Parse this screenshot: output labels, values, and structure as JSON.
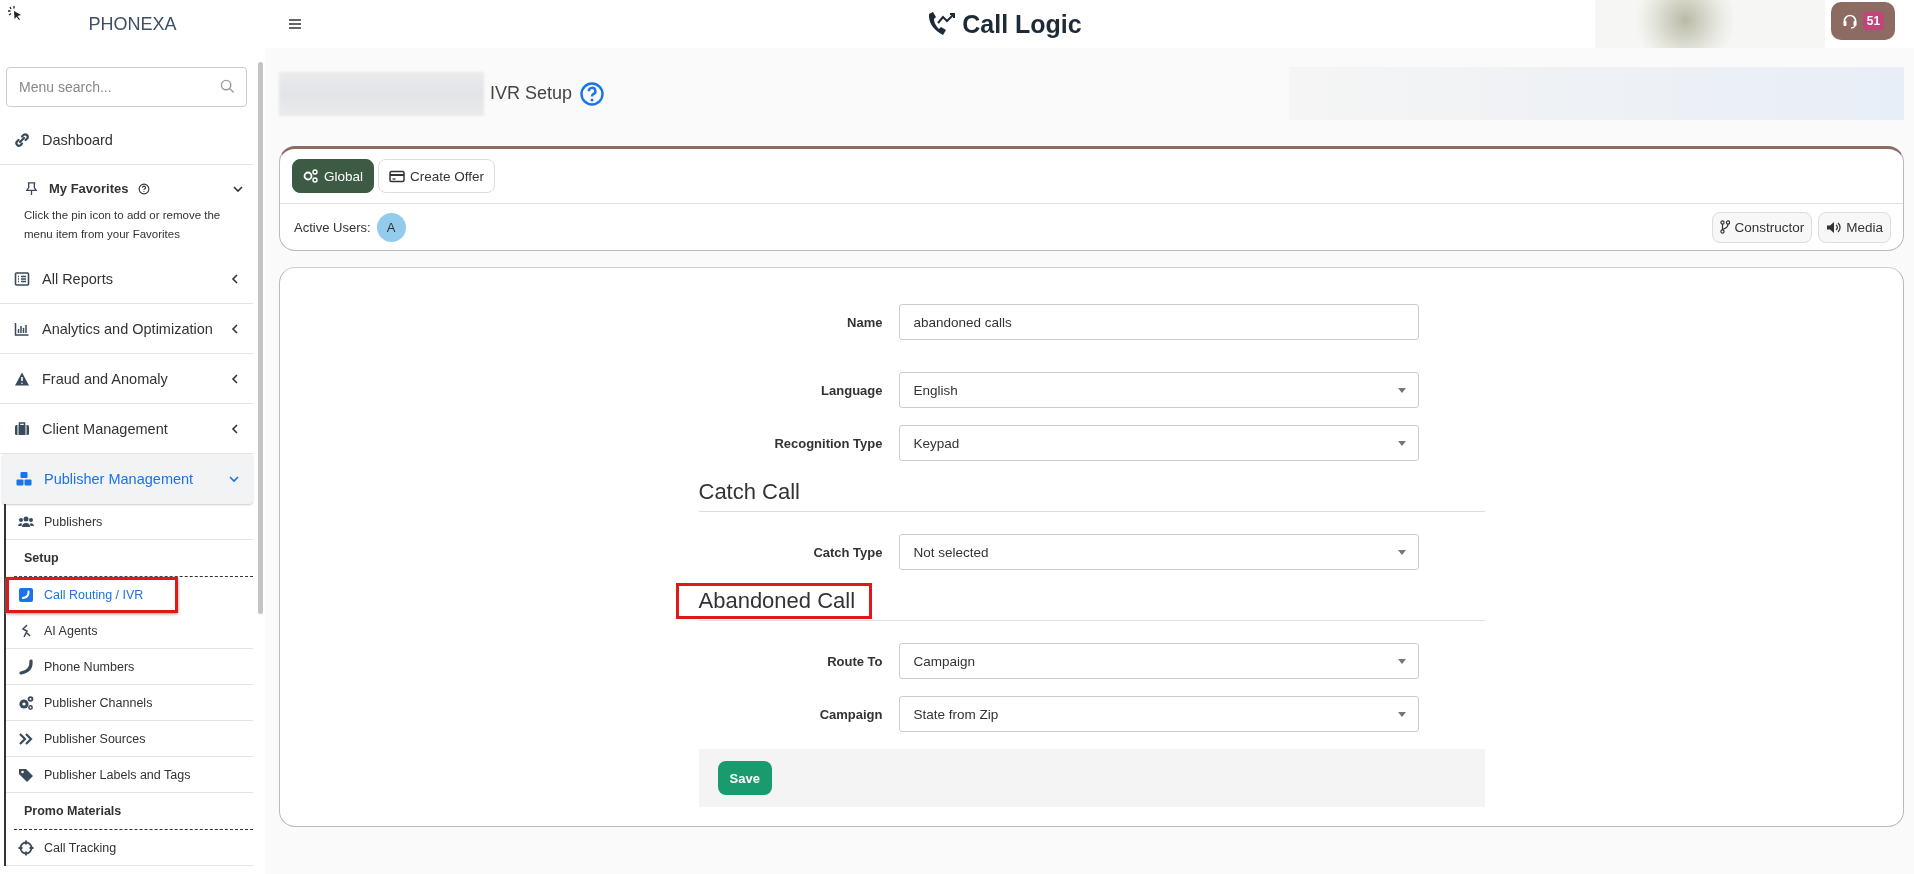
{
  "header": {
    "logo": "PHONEXA",
    "app_title": "Call Logic",
    "notification_count": "51"
  },
  "sidebar": {
    "search": {
      "placeholder": "Menu search..."
    },
    "items": [
      {
        "kind": "link",
        "label": "Dashboard",
        "selected": false
      },
      {
        "kind": "favorites",
        "label": "My Favorites",
        "expanded": true,
        "description": "Click the pin icon to add or remove the menu item from your Favorites"
      },
      {
        "kind": "group",
        "label": "All Reports",
        "expanded": false
      },
      {
        "kind": "group",
        "label": "Analytics and Optimization",
        "expanded": false
      },
      {
        "kind": "group",
        "label": "Fraud and Anomaly",
        "expanded": false
      },
      {
        "kind": "group",
        "label": "Client Management",
        "expanded": false
      },
      {
        "kind": "group",
        "label": "Publisher Management",
        "expanded": true,
        "children": [
          {
            "kind": "link",
            "label": "Publishers",
            "selected": false,
            "highlighted": false
          },
          {
            "kind": "heading",
            "label": "Setup"
          },
          {
            "kind": "link",
            "label": "Call Routing / IVR",
            "selected": true,
            "highlighted": true
          },
          {
            "kind": "link",
            "label": "AI Agents",
            "selected": false,
            "highlighted": false
          },
          {
            "kind": "link",
            "label": "Phone Numbers",
            "selected": false,
            "highlighted": false
          },
          {
            "kind": "link",
            "label": "Publisher Channels",
            "selected": false,
            "highlighted": false
          },
          {
            "kind": "link",
            "label": "Publisher Sources",
            "selected": false,
            "highlighted": false
          },
          {
            "kind": "link",
            "label": "Publisher Labels and Tags",
            "selected": false,
            "highlighted": false
          },
          {
            "kind": "heading",
            "label": "Promo Materials"
          },
          {
            "kind": "link",
            "label": "Call Tracking",
            "selected": false,
            "highlighted": false
          }
        ]
      }
    ]
  },
  "page": {
    "title": "IVR Setup"
  },
  "toolbar": {
    "tabs": [
      {
        "label": "Global",
        "selected": true
      },
      {
        "label": "Create Offer",
        "selected": false
      }
    ],
    "active_users_label": "Active Users:",
    "active_users": [
      {
        "initial": "A"
      }
    ],
    "buttons": [
      "Constructor",
      "Media"
    ]
  },
  "form": {
    "rows": [
      {
        "kind": "text_field",
        "label": "Name",
        "value": "abandoned calls"
      },
      {
        "kind": "select_field",
        "label": "Language",
        "value": "English"
      },
      {
        "kind": "select_field",
        "label": "Recognition Type",
        "value": "Keypad"
      },
      {
        "kind": "heading",
        "text": "Catch Call",
        "highlighted": false
      },
      {
        "kind": "select_field",
        "label": "Catch Type",
        "value": "Not selected"
      },
      {
        "kind": "heading",
        "text": "Abandoned Call",
        "highlighted": true
      },
      {
        "kind": "select_field",
        "label": "Route To",
        "value": "Campaign"
      },
      {
        "kind": "select_field",
        "label": "Campaign",
        "value": "State from Zip"
      }
    ],
    "save_label": "Save"
  }
}
